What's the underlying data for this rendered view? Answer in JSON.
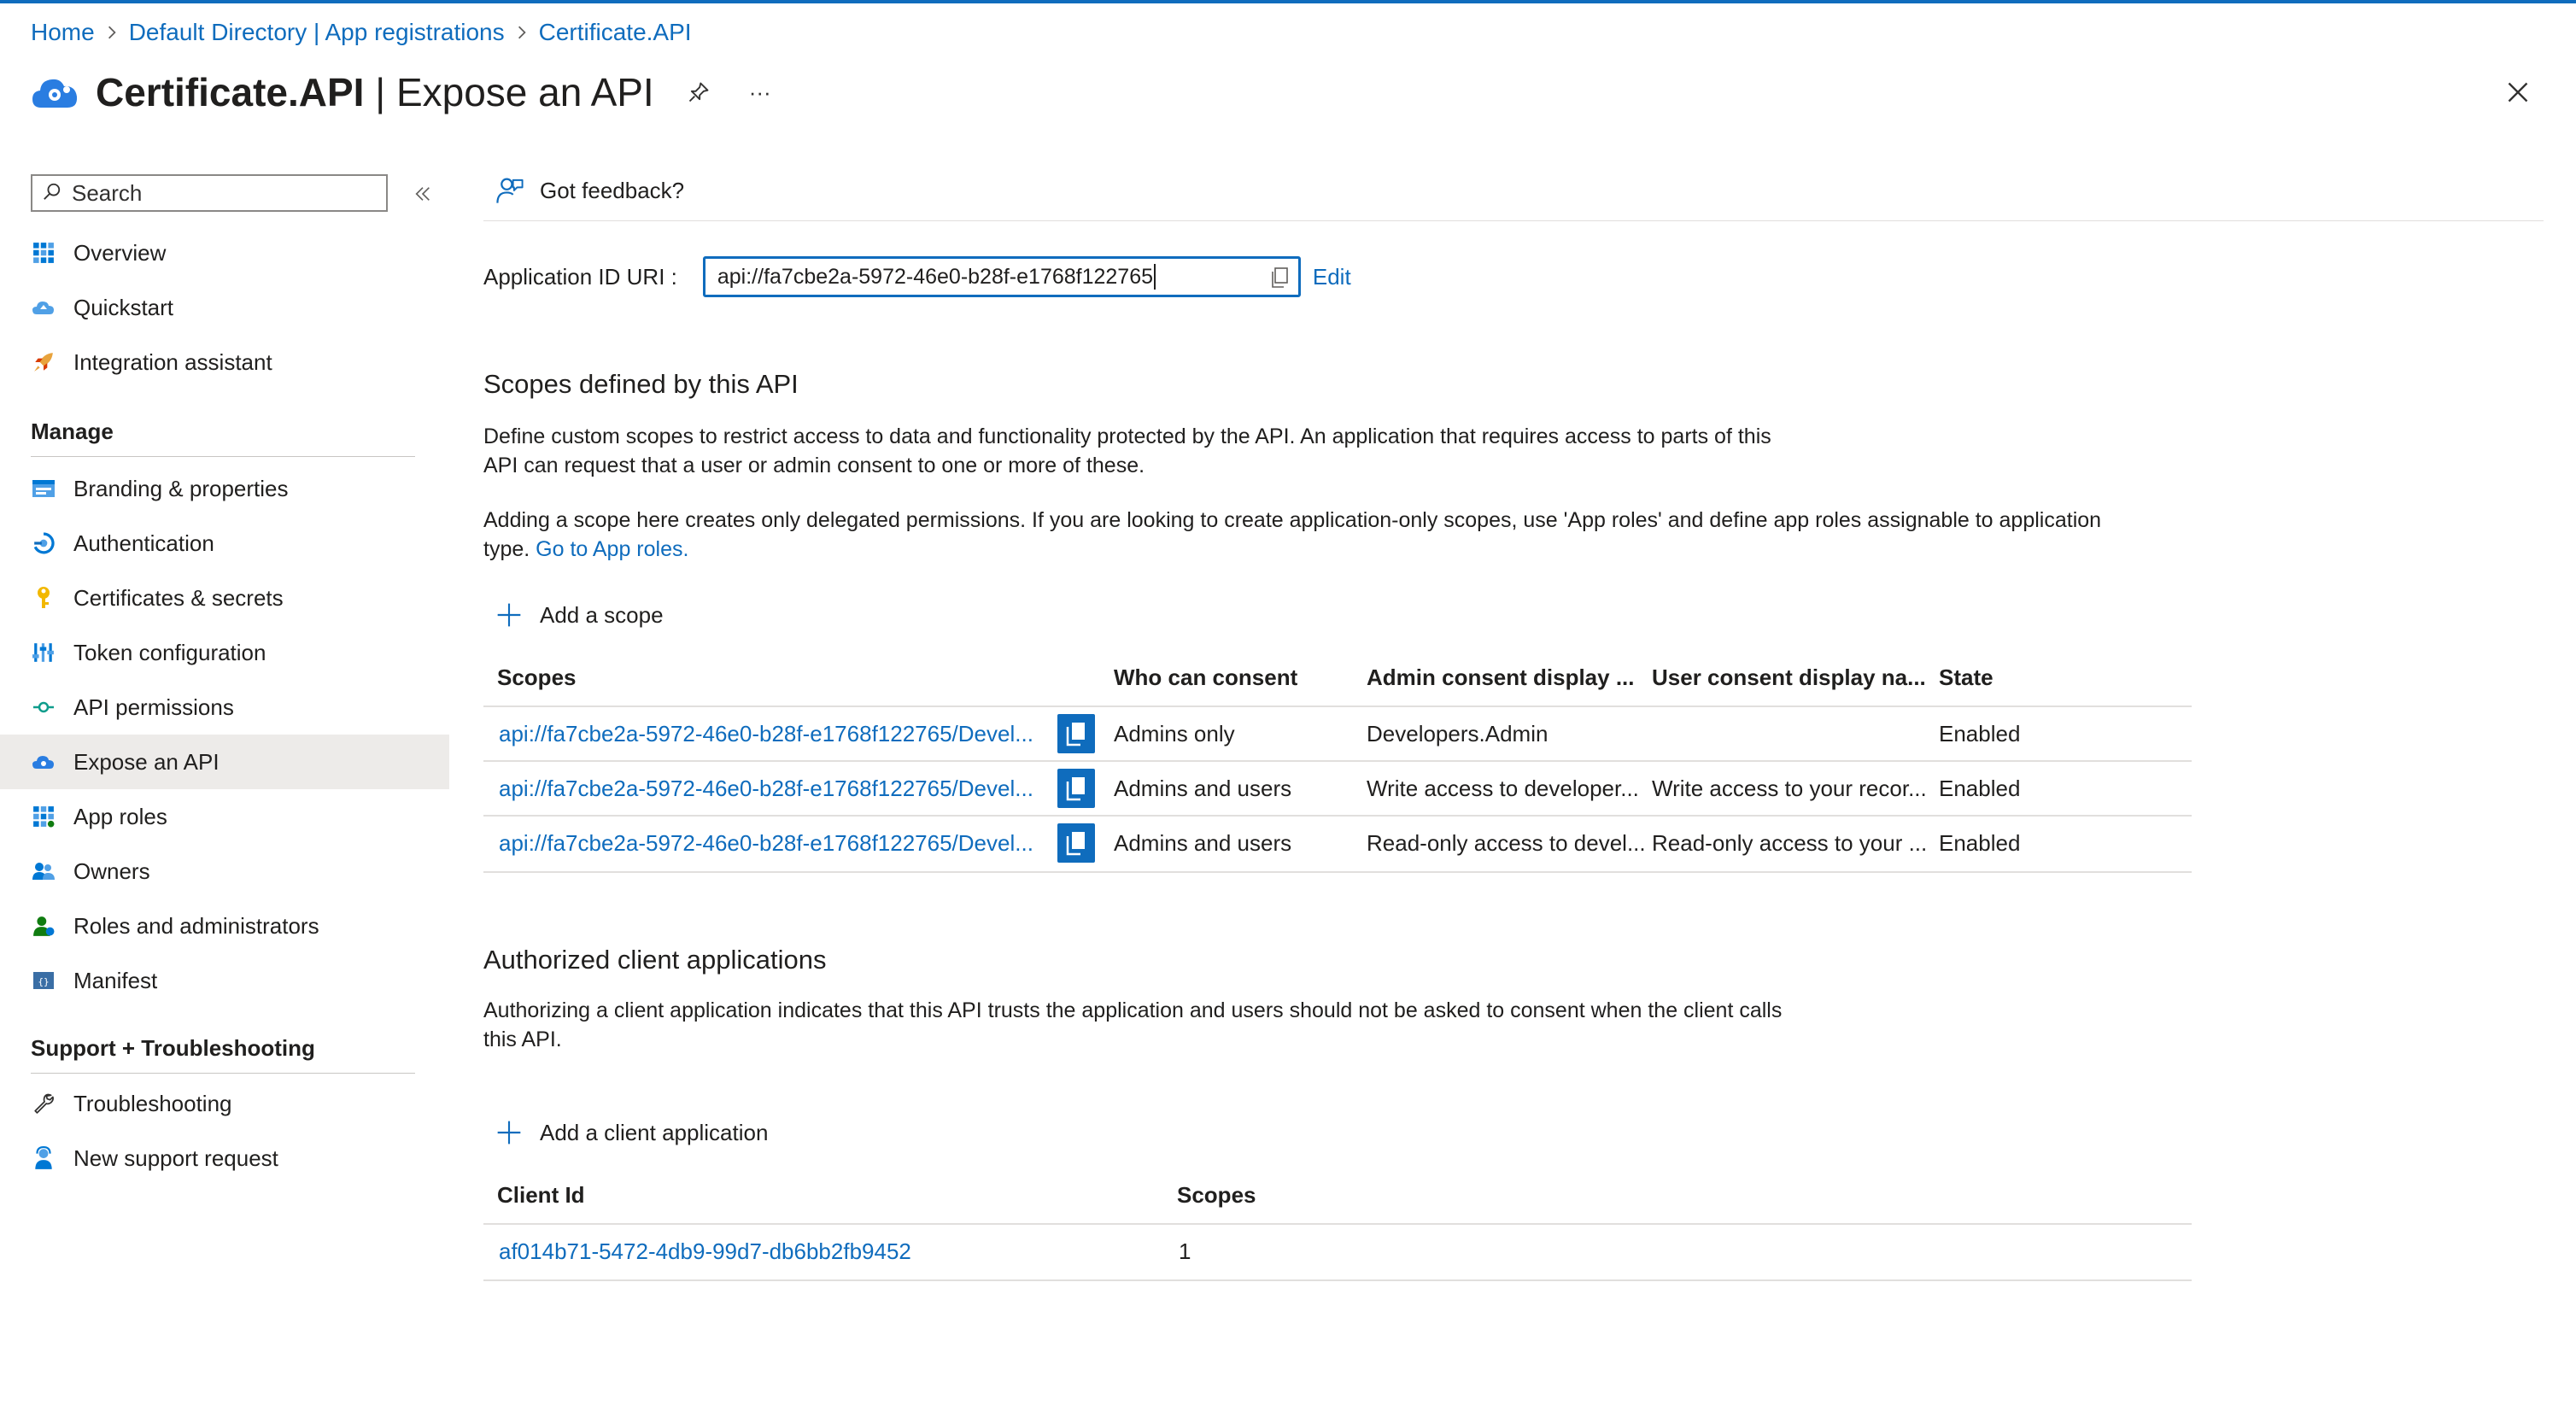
{
  "breadcrumb": [
    "Home",
    "Default Directory | App registrations",
    "Certificate.API"
  ],
  "header": {
    "title_name": "Certificate.API",
    "title_rest": " | Expose an API",
    "more_label": "···"
  },
  "sidebar": {
    "search_placeholder": "Search",
    "items_top": [
      {
        "label": "Overview",
        "icon": "overview-icon"
      },
      {
        "label": "Quickstart",
        "icon": "quickstart-icon"
      },
      {
        "label": "Integration assistant",
        "icon": "rocket-icon"
      }
    ],
    "manage_heading": "Manage",
    "items_manage": [
      {
        "label": "Branding & properties",
        "icon": "branding-icon"
      },
      {
        "label": "Authentication",
        "icon": "authentication-icon"
      },
      {
        "label": "Certificates & secrets",
        "icon": "key-icon"
      },
      {
        "label": "Token configuration",
        "icon": "token-icon"
      },
      {
        "label": "API permissions",
        "icon": "api-permissions-icon"
      },
      {
        "label": "Expose an API",
        "icon": "cloud-icon",
        "active": true
      },
      {
        "label": "App roles",
        "icon": "app-roles-icon"
      },
      {
        "label": "Owners",
        "icon": "owners-icon"
      },
      {
        "label": "Roles and administrators",
        "icon": "roles-icon"
      },
      {
        "label": "Manifest",
        "icon": "manifest-icon"
      }
    ],
    "support_heading": "Support + Troubleshooting",
    "items_support": [
      {
        "label": "Troubleshooting",
        "icon": "wrench-icon"
      },
      {
        "label": "New support request",
        "icon": "support-person-icon"
      }
    ]
  },
  "main": {
    "feedback_label": "Got feedback?",
    "app_id_uri_label": "Application ID URI :",
    "app_id_uri_value": "api://fa7cbe2a-5972-46e0-b28f-e1768f122765",
    "edit_label": "Edit",
    "scopes_section": {
      "title": "Scopes defined by this API",
      "para1_line1": "Define custom scopes to restrict access to data and functionality protected by the API. An application that requires access to parts of this",
      "para1_line2": "API can request that a user or admin consent to one or more of these.",
      "para2_line1": "Adding a scope here creates only delegated permissions. If you are looking to create application-only scopes, use 'App roles' and define app roles assignable to application",
      "para2_line2_prefix": "type.",
      "para2_link": "Go to App roles.",
      "add_label": "Add a scope",
      "columns": [
        "Scopes",
        "Who can consent",
        "Admin consent display ...",
        "User consent display na...",
        "State"
      ],
      "rows": [
        [
          "api://fa7cbe2a-5972-46e0-b28f-e1768f122765/Devel...",
          "Admins only",
          "Developers.Admin",
          "",
          "Enabled"
        ],
        [
          "api://fa7cbe2a-5972-46e0-b28f-e1768f122765/Devel...",
          "Admins and users",
          "Write access to developer...",
          "Write access to your recor...",
          "Enabled"
        ],
        [
          "api://fa7cbe2a-5972-46e0-b28f-e1768f122765/Devel...",
          "Admins and users",
          "Read-only access to devel...",
          "Read-only access to your ...",
          "Enabled"
        ]
      ]
    },
    "clients_section": {
      "title": "Authorized client applications",
      "para_line1": "Authorizing a client application indicates that this API trusts the application and users should not be asked to consent when the client calls",
      "para_line2": "this API.",
      "add_label": "Add a client application",
      "columns": [
        "Client Id",
        "Scopes"
      ],
      "rows": [
        [
          "af014b71-5472-4db9-99d7-db6bb2fb9452",
          "1"
        ]
      ]
    }
  },
  "colors": {
    "accent": "#0f6cbd",
    "active_bg": "#edebe9",
    "text": "#201f1e"
  }
}
